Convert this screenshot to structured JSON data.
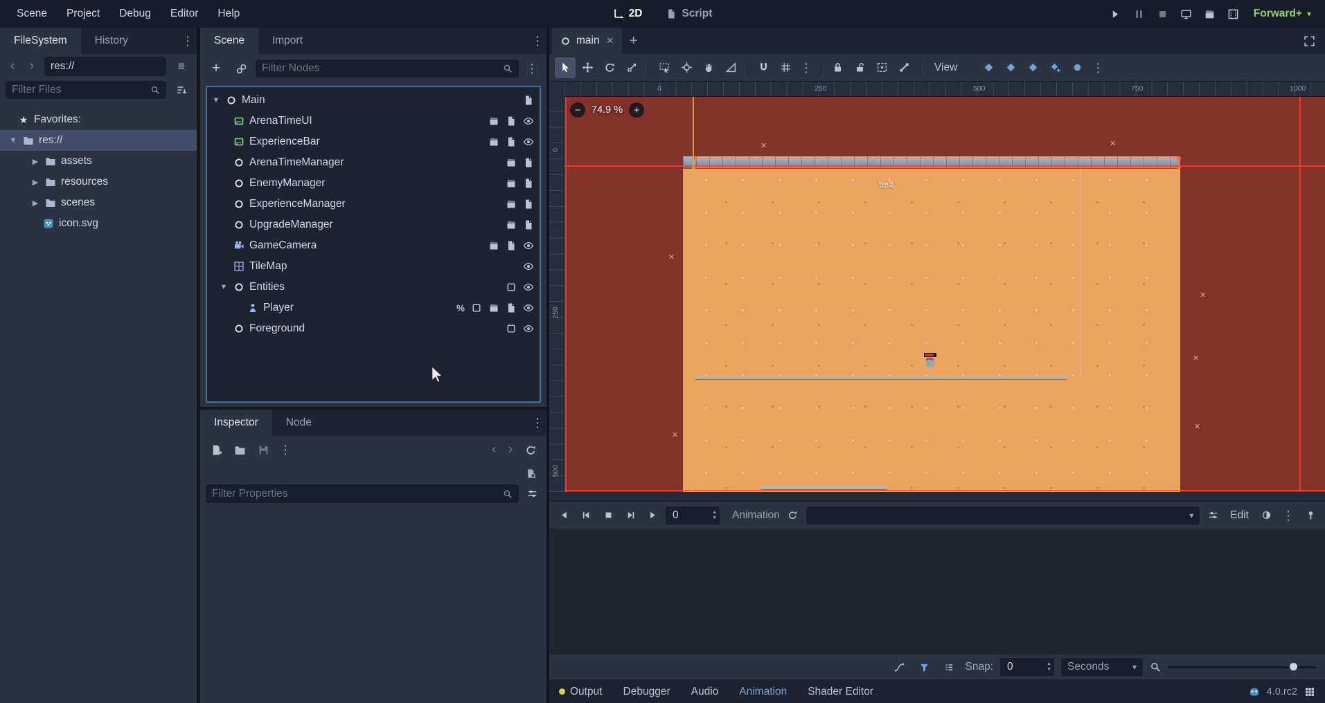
{
  "menubar": {
    "items": [
      "Scene",
      "Project",
      "Debug",
      "Editor",
      "Help"
    ]
  },
  "workspace": {
    "tabs": [
      "2D",
      "Script"
    ]
  },
  "runbar": {
    "renderer": "Forward+"
  },
  "filesystem": {
    "tab_filesystem": "FileSystem",
    "tab_history": "History",
    "path": "res://",
    "filter_placeholder": "Filter Files",
    "favorites_label": "Favorites:",
    "items": [
      {
        "label": "res://"
      },
      {
        "label": "assets"
      },
      {
        "label": "resources"
      },
      {
        "label": "scenes"
      },
      {
        "label": "icon.svg"
      }
    ]
  },
  "scene_dock": {
    "tab_scene": "Scene",
    "tab_import": "Import",
    "filter_placeholder": "Filter Nodes",
    "nodes": [
      {
        "name": "Main"
      },
      {
        "name": "ArenaTimeUI"
      },
      {
        "name": "ExperienceBar"
      },
      {
        "name": "ArenaTimeManager"
      },
      {
        "name": "EnemyManager"
      },
      {
        "name": "ExperienceManager"
      },
      {
        "name": "UpgradeManager"
      },
      {
        "name": "GameCamera"
      },
      {
        "name": "TileMap"
      },
      {
        "name": "Entities"
      },
      {
        "name": "Player"
      },
      {
        "name": "Foreground"
      }
    ]
  },
  "inspector": {
    "tab_inspector": "Inspector",
    "tab_node": "Node",
    "filter_placeholder": "Filter Properties"
  },
  "viewport": {
    "scene_tab": "main",
    "view_menu": "View",
    "zoom": "74.9 %",
    "h_ruler": [
      "0",
      "250",
      "500",
      "750",
      "1000"
    ],
    "v_ruler": [
      "0",
      "250",
      "500"
    ],
    "canvas_label": "test"
  },
  "animation": {
    "frame": "0",
    "label": "Animation",
    "edit": "Edit",
    "snap_label": "Snap:",
    "snap_value": "0",
    "unit": "Seconds"
  },
  "statusbar": {
    "items": [
      "Output",
      "Debugger",
      "Audio",
      "Animation",
      "Shader Editor"
    ],
    "version": "4.0.rc2"
  }
}
